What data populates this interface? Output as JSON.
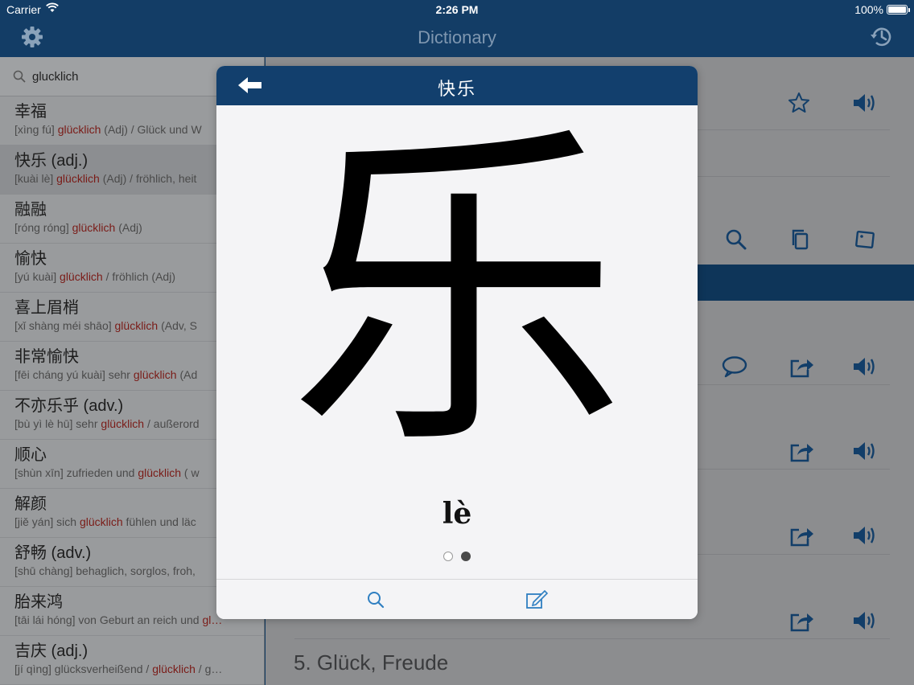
{
  "status_bar": {
    "carrier": "Carrier",
    "time": "2:26 PM",
    "battery": "100%"
  },
  "nav": {
    "title": "Dictionary",
    "left_icon": "gear-icon",
    "right_icon": "history-icon"
  },
  "search": {
    "query": "glucklich",
    "placeholder": ""
  },
  "results": [
    {
      "hw": "幸福",
      "pinyin": "[xìng fú]",
      "hl": "glücklich",
      "rest": " (Adj) / Glück und W"
    },
    {
      "hw": "快乐 (adj.)",
      "pinyin": "[kuài lè]",
      "hl": "glücklich",
      "rest": " (Adj) / fröhlich, heit"
    },
    {
      "hw": "融融",
      "pinyin": "[róng róng]",
      "hl": "glücklich",
      "rest": " (Adj)"
    },
    {
      "hw": "愉快",
      "pinyin": "[yú kuài]",
      "hl": "glücklich",
      "rest": " / fröhlich (Adj)"
    },
    {
      "hw": "喜上眉梢",
      "pinyin": "[xǐ shàng méi shāo]",
      "hl": "glücklich",
      "rest": " (Adv, S"
    },
    {
      "hw": "非常愉快",
      "pinyin": "[fēi cháng yú kuài] sehr",
      "hl": "glücklich",
      "rest": " (Ad"
    },
    {
      "hw": "不亦乐乎 (adv.)",
      "pinyin": "[bù yì lè hū] sehr",
      "hl": "glücklich",
      "rest": " / außerord"
    },
    {
      "hw": "顺心",
      "pinyin": "[shùn xīn] zufrieden und",
      "hl": "glücklich",
      "rest": " ( w"
    },
    {
      "hw": "解颜",
      "pinyin": "[jiě yán] sich",
      "hl": "glücklich",
      "rest": " fühlen und läc"
    },
    {
      "hw": "舒畅 (adv.)",
      "pinyin": "[shū chàng] behaglich, sorglos, froh,",
      "hl": "",
      "rest": ""
    },
    {
      "hw": "胎来鸿",
      "pinyin": "[tāi lái hóng] von Geburt an reich und",
      "hl": "gl…",
      "rest": ""
    },
    {
      "hw": "吉庆 (adj.)",
      "pinyin": "[jí qìng] glücksverheißend /",
      "hl": "glücklich",
      "rest": " / g…"
    }
  ],
  "detail": {
    "visible_heading": "5. Glück, Freude"
  },
  "modal": {
    "title": "快乐",
    "character": "乐",
    "pinyin": "lè",
    "page_count": 2,
    "current_page": 2
  },
  "colors": {
    "nav_bg": "#133d66",
    "modal_header": "#123f6d",
    "accent": "#2f7fc1",
    "highlight": "#7a1b17"
  }
}
